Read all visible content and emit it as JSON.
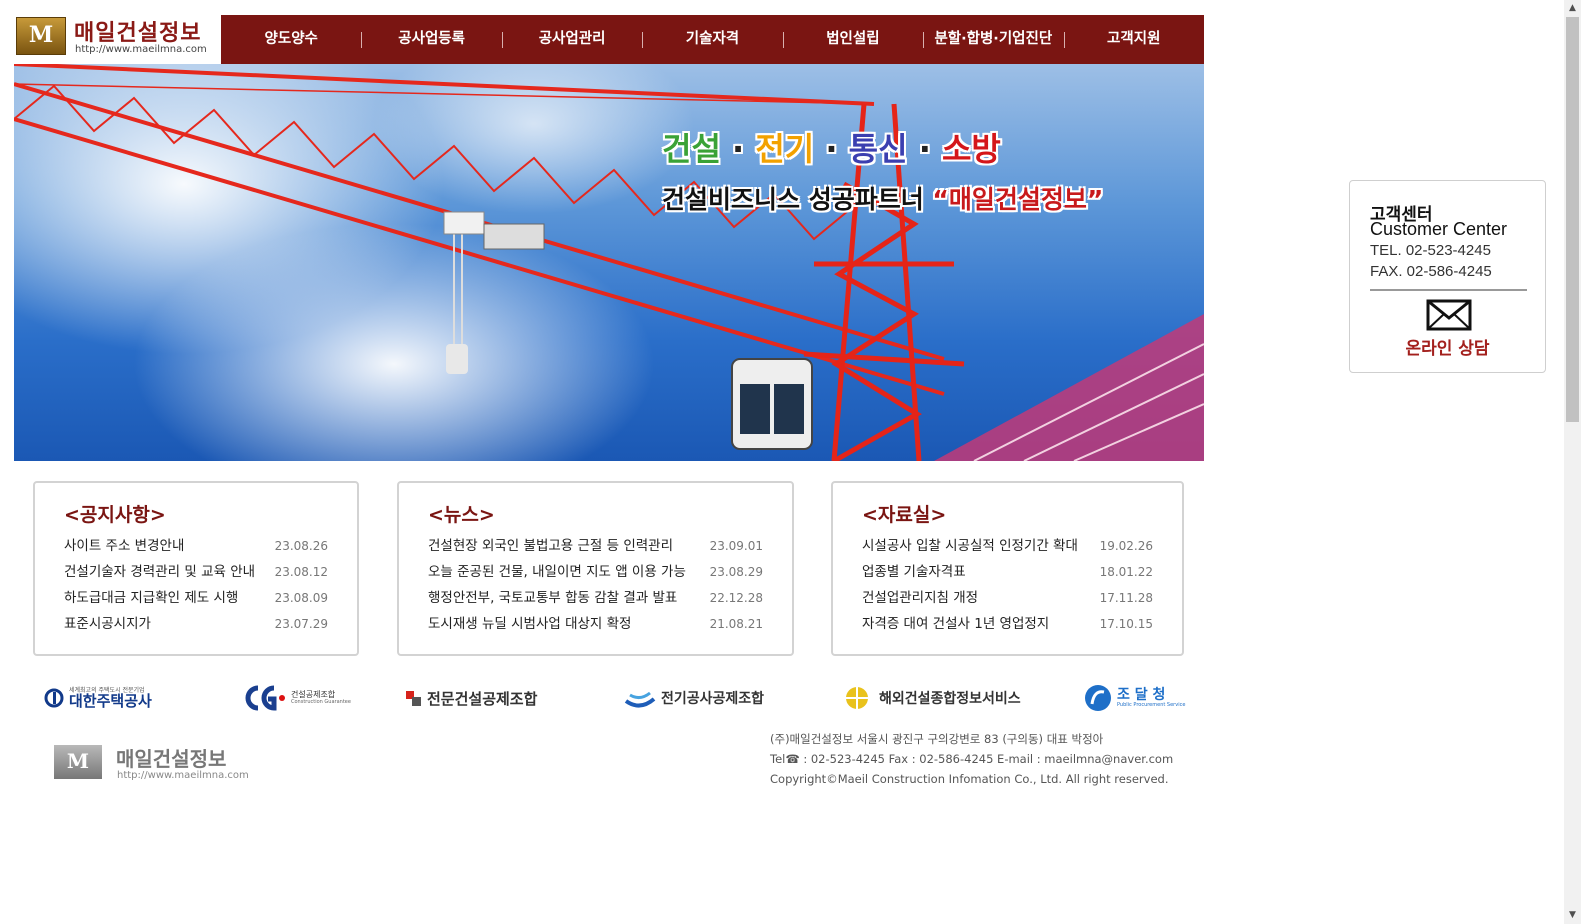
{
  "logo": {
    "mark": "M",
    "title": "매일건설정보",
    "url": "http://www.maeilmna.com"
  },
  "nav": [
    "양도양수",
    "공사업등록",
    "공사업관리",
    "기술자격",
    "법인설립",
    "분할·합병·기업진단",
    "고객지원"
  ],
  "hero": {
    "line1": [
      "건설",
      " · ",
      "전기",
      " · ",
      "통신",
      " · ",
      "소방"
    ],
    "line1_colors": [
      "#3aa236",
      "#222",
      "#f2a100",
      "#222",
      "#3b3fb0",
      "#222",
      "#d4161a"
    ],
    "line2_prefix": "건설비즈니스 성공파트너 ",
    "line2_accent": "“매일건설정보”"
  },
  "boards": [
    {
      "title": "<공지사항>",
      "items": [
        {
          "title": "사이트 주소 변경안내",
          "date": "23.08.26"
        },
        {
          "title": "건설기술자 경력관리 및 교육 안내",
          "date": "23.08.12"
        },
        {
          "title": "하도급대금 지급확인 제도 시행",
          "date": "23.08.09"
        },
        {
          "title": "표준시공시지가",
          "date": "23.07.29"
        }
      ]
    },
    {
      "title": "<뉴스>",
      "items": [
        {
          "title": "건설현장 외국인 불법고용 근절 등 인력관리",
          "date": "23.09.01"
        },
        {
          "title": "오늘 준공된 건물, 내일이면 지도 앱 이용 가능",
          "date": "23.08.29"
        },
        {
          "title": "행정안전부, 국토교통부 합동 감찰 결과 발표",
          "date": "22.12.28"
        },
        {
          "title": "도시재생 뉴딜 시범사업 대상지 확정",
          "date": "21.08.21"
        }
      ]
    },
    {
      "title": "<자료실>",
      "items": [
        {
          "title": "시설공사 입찰 시공실적 인정기간 확대",
          "date": "19.02.26"
        },
        {
          "title": "업종별 기술자격표",
          "date": "18.01.22"
        },
        {
          "title": "건설업관리지침 개정",
          "date": "17.11.28"
        },
        {
          "title": "자격증 대여 건설사 1년 영업정지",
          "date": "17.10.15"
        }
      ]
    }
  ],
  "partners": [
    {
      "name": "대한주택공사",
      "sub": "세계최고의 주택도시 전문기업"
    },
    {
      "name": "건설공제조합",
      "sub": "Construction Guarantee"
    },
    {
      "name": "전문건설공제조합"
    },
    {
      "name": "전기공사공제조합"
    },
    {
      "name": "해외건설종합정보서비스"
    },
    {
      "name": "조 달 청",
      "sub": "Public Procurement Service"
    }
  ],
  "footer": {
    "logo_title": "매일건설정보",
    "logo_url": "http://www.maeilmna.com",
    "line1": "(주)매일건설정보 서울시 광진구 구의강변로 83 (구의동) 대표 박정아",
    "line2": "Tel☎ : 02-523-4245 Fax : 02-586-4245 E-mail : maeilmna@naver.com",
    "line3": "Copyright©Maeil Construction Infomation Co., Ltd. All right reserved."
  },
  "customer_center": {
    "title_kr": "고객센터",
    "title_en": "Customer Center",
    "tel": "TEL. 02-523-4245",
    "fax": "FAX. 02-586-4245",
    "online": "온라인 상담"
  },
  "colors": {
    "brand": "#7a1512",
    "accent": "#a3201d"
  }
}
